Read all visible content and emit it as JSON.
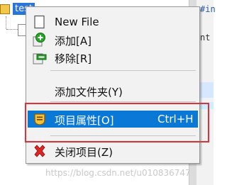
{
  "tree": {
    "root_label": "test"
  },
  "editor": {
    "line1": "#in",
    "line2": "nt",
    "line3": ""
  },
  "menu": {
    "items": [
      {
        "label": "New File",
        "shortcut": "",
        "icon": "blank-file-icon"
      },
      {
        "label": "添加[A]",
        "shortcut": "",
        "icon": "add-green-plus-icon"
      },
      {
        "label": "移除[R]",
        "shortcut": "",
        "icon": "remove-minus-icon"
      },
      {
        "label": "添加文件夹(Y)",
        "shortcut": "",
        "icon": ""
      },
      {
        "label": "项目属性[O]",
        "shortcut": "Ctrl+H",
        "icon": "project-properties-icon",
        "selected": true
      },
      {
        "label": "关闭项目(Z)",
        "shortcut": "",
        "icon": "red-x-icon"
      }
    ]
  },
  "watermark": "https://blog.csdn.net/u010836747",
  "colors": {
    "selection": "#0a78d7",
    "annotation_box": "#e0303a",
    "menu_bg": "#f2f2f2"
  }
}
